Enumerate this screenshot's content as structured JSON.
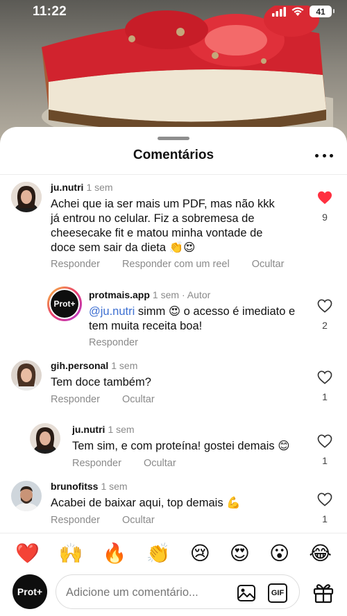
{
  "status_bar": {
    "time": "11:22",
    "battery": "41"
  },
  "sheet": {
    "title": "Comentários"
  },
  "comments": [
    {
      "username": "ju.nutri",
      "time": "1 sem",
      "text": "Achei que ia ser mais um PDF, mas não kkk já entrou no celular. Fiz a sobremesa de cheesecake fit e matou minha vontade de doce sem sair da dieta 👏😍",
      "actions": [
        "Responder",
        "Responder com um reel",
        "Ocultar"
      ],
      "likes": "9",
      "liked": true
    },
    {
      "username": "protmais.app",
      "time": "1 sem",
      "author": "· Autor",
      "mention": "@ju.nutri",
      "text": " simm 😍 o acesso é imediato e tem muita receita boa!",
      "avatar_text": "Prot+",
      "actions": [
        "Responder"
      ],
      "likes": "2",
      "liked": false
    },
    {
      "username": "gih.personal",
      "time": "1 sem",
      "text": "Tem doce também?",
      "actions": [
        "Responder",
        "Ocultar"
      ],
      "likes": "1",
      "liked": false
    },
    {
      "username": "ju.nutri",
      "time": "1 sem",
      "text": "Tem sim, e com proteína! gostei demais 😊",
      "actions": [
        "Responder",
        "Ocultar"
      ],
      "likes": "1",
      "liked": false
    },
    {
      "username": "brunofitss",
      "time": "1 sem",
      "text": "Acabei de baixar aqui, top demais 💪",
      "actions": [
        "Responder",
        "Ocultar"
      ],
      "likes": "1",
      "liked": false
    }
  ],
  "emoji_bar": [
    "❤️",
    "🙌",
    "🔥",
    "👏",
    "😢",
    "😍",
    "😮",
    "😂"
  ],
  "composer": {
    "avatar_text": "Prot+",
    "placeholder": "Adicione um comentário...",
    "gif_label": "GIF"
  },
  "colors": {
    "like_red": "#ff3040",
    "mention_blue": "#3d6fd1",
    "muted_gray": "#8a8a8a"
  },
  "icons": [
    "signal-icon",
    "wifi-icon",
    "battery-icon",
    "more-icon",
    "heart-icon",
    "image-icon",
    "gif-icon",
    "gift-icon"
  ]
}
